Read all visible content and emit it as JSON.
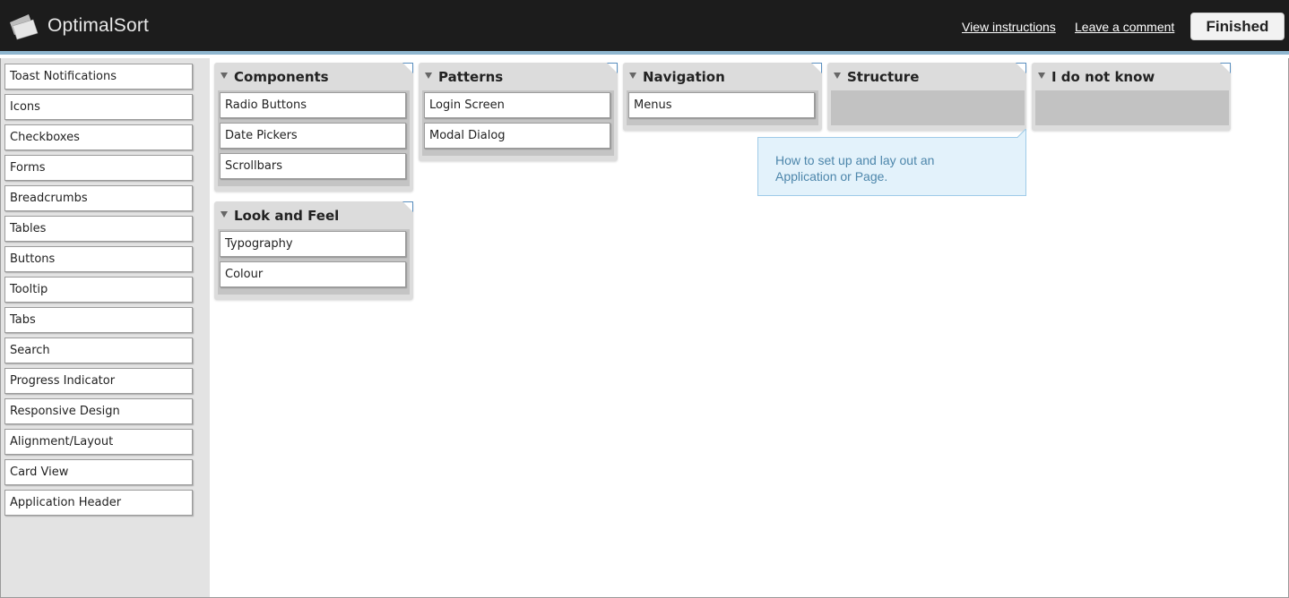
{
  "header": {
    "logo_text": "OptimalSort",
    "view_instructions": "View instructions",
    "leave_comment": "Leave a comment",
    "finished": "Finished"
  },
  "unsorted_cards": [
    "Toast Notifications",
    "Icons",
    "Checkboxes",
    "Forms",
    "Breadcrumbs",
    "Tables",
    "Buttons",
    "Tooltip",
    "Tabs",
    "Search",
    "Progress Indicator",
    "Responsive Design",
    "Alignment/Layout",
    "Card View",
    "Application Header"
  ],
  "groups": {
    "components": {
      "title": "Components",
      "cards": [
        "Radio Buttons",
        "Date Pickers",
        "Scrollbars"
      ]
    },
    "patterns": {
      "title": "Patterns",
      "cards": [
        "Login Screen",
        "Modal Dialog"
      ]
    },
    "navigation": {
      "title": "Navigation",
      "cards": [
        "Menus"
      ]
    },
    "structure": {
      "title": "Structure",
      "cards": []
    },
    "idk": {
      "title": "I do not know",
      "cards": []
    },
    "look_feel": {
      "title": "Look and Feel",
      "cards": [
        "Typography",
        "Colour"
      ]
    }
  },
  "tooltip": {
    "text_line1": "How to set up and lay out an",
    "text_line2": "Application or Page."
  },
  "colors": {
    "header_bg": "#1c1c1c",
    "accent": "#8fb6cf",
    "tooltip_text": "#4d86ab"
  }
}
